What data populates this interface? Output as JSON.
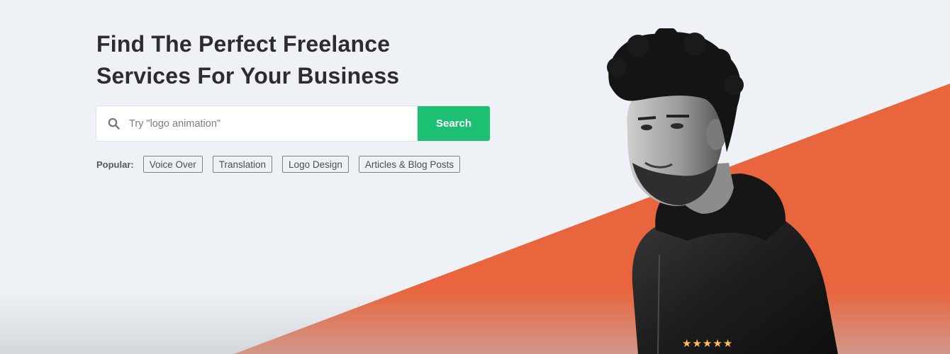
{
  "hero": {
    "title_line1": "Find The Perfect Freelance",
    "title_line2": "Services For Your Business",
    "accent_color": "#e8653e",
    "background_color": "#eef1f5"
  },
  "search": {
    "placeholder": "Try \"logo animation\"",
    "value": "",
    "button_label": "Search",
    "button_color": "#1dbf73",
    "icon": "search-icon"
  },
  "popular": {
    "label": "Popular:",
    "tags": [
      "Voice Over",
      "Translation",
      "Logo Design",
      "Articles & Blog Posts"
    ]
  },
  "rating": {
    "stars": 5,
    "max": 5
  }
}
